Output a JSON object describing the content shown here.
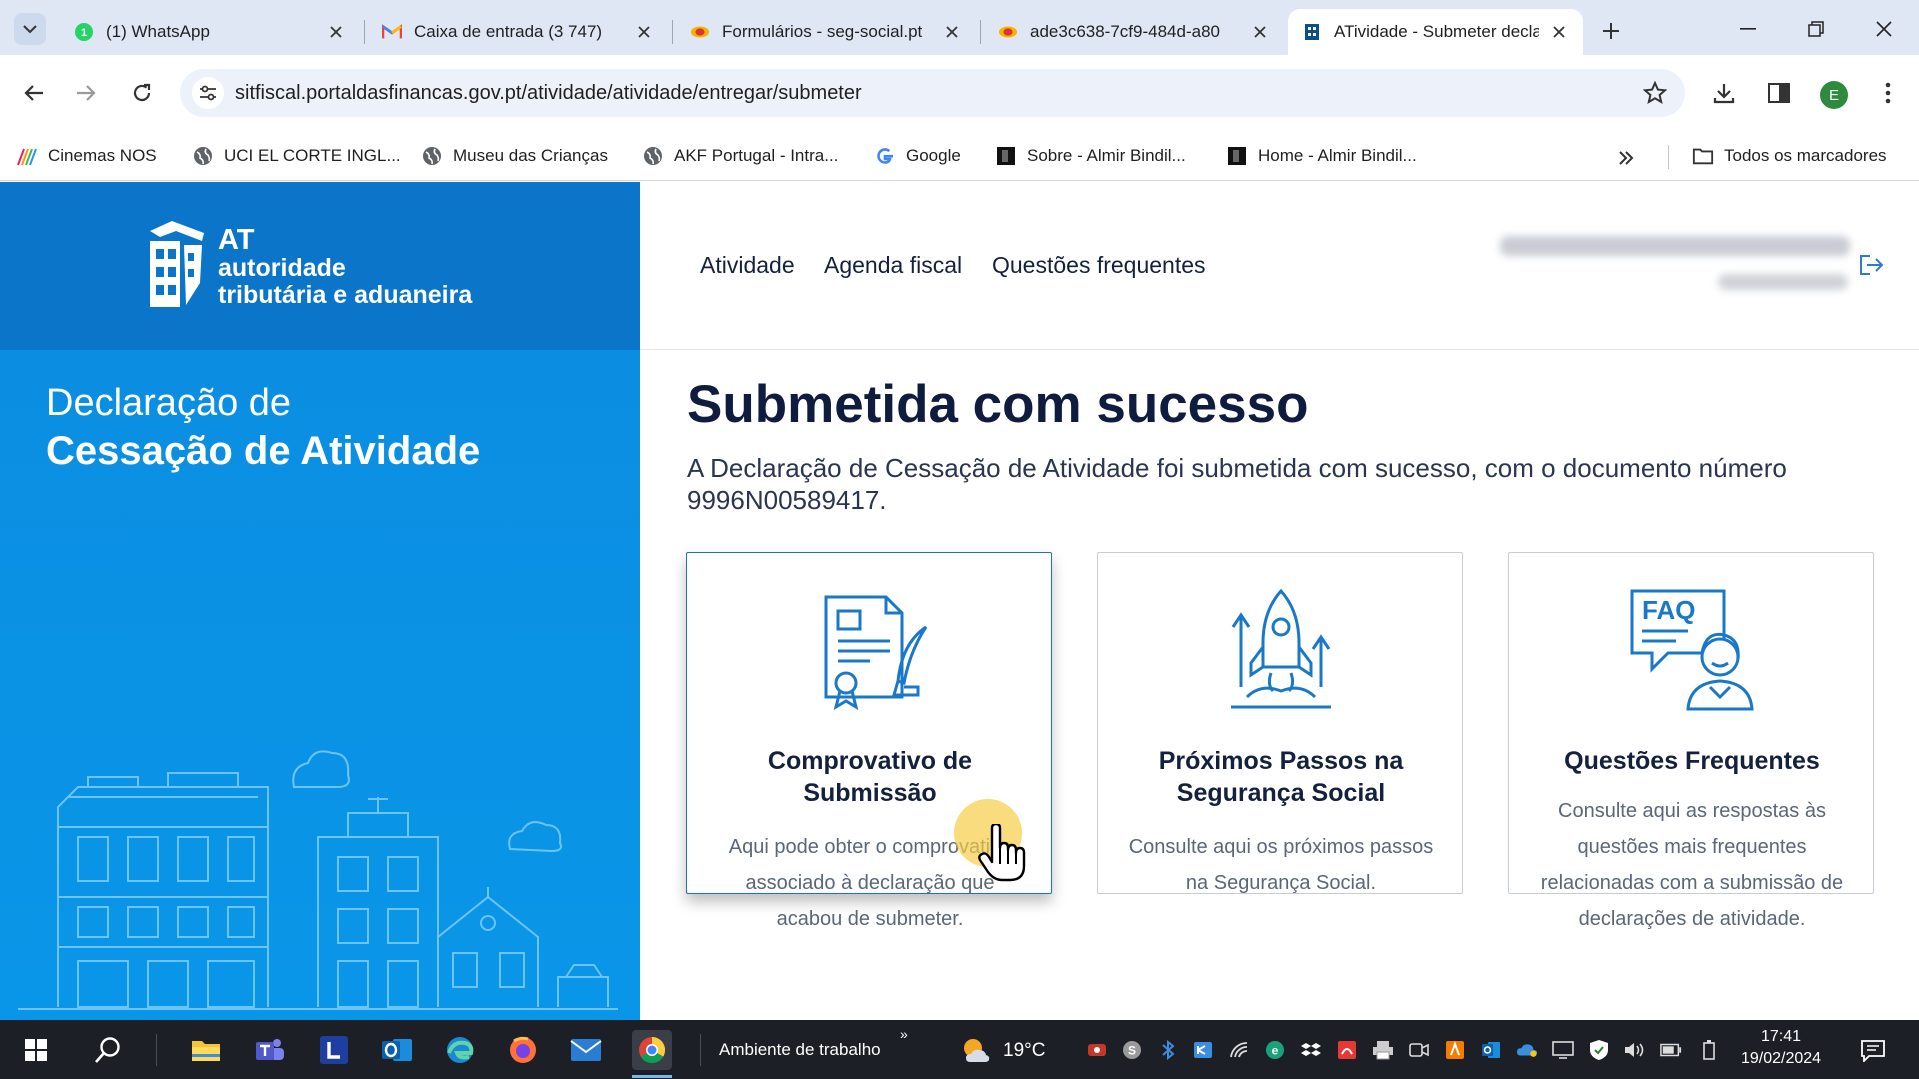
{
  "browser": {
    "tabs": [
      {
        "title": "(1) WhatsApp",
        "active": false
      },
      {
        "title": "Caixa de entrada (3 747)",
        "active": false
      },
      {
        "title": "Formulários - seg-social.pt",
        "active": false
      },
      {
        "title": "ade3c638-7cf9-484d-a80",
        "active": false
      },
      {
        "title": "ATividade - Submeter declaração",
        "active": true
      }
    ],
    "url": "sitfiscal.portaldasfinancas.gov.pt/atividade/atividade/entregar/submeter",
    "profile_initial": "E",
    "bookmarks": [
      "Cinemas NOS",
      "UCI EL CORTE INGL...",
      "Museu das Crianças",
      "AKF Portugal - Intra...",
      "Google",
      "Sobre - Almir Bindil...",
      "Home - Almir Bindil..."
    ],
    "all_bookmarks_label": "Todos os marcadores"
  },
  "page": {
    "logo": {
      "line1": "AT",
      "line2": "autoridade",
      "line3": "tributária e aduaneira"
    },
    "declaration": {
      "line1": "Declaração de",
      "line2": "Cessação de Atividade"
    },
    "nav": [
      "Atividade",
      "Agenda fiscal",
      "Questões frequentes"
    ],
    "title": "Submetida com sucesso",
    "description": "A Declaração de Cessação de Atividade foi submetida com sucesso, com o documento número 9996N00589417.",
    "cards": [
      {
        "title": "Comprovativo de Submissão",
        "desc": "Aqui pode obter o comprovativo associado à declaração que acabou de submeter."
      },
      {
        "title": "Próximos Passos na Segurança Social",
        "desc": "Consulte aqui os próximos passos na Segurança Social."
      },
      {
        "title": "Questões Frequentes",
        "desc": "Consulte aqui as respostas às questões mais frequentes relacionadas com a submissão de declarações de atividade."
      }
    ],
    "faq_badge": "FAQ"
  },
  "taskbar": {
    "desktop_label": "Ambiente de trabalho",
    "temperature": "19°C",
    "time": "17:41",
    "date": "19/02/2024"
  },
  "colors": {
    "brand_blue": "#0a75c9",
    "panel_blue": "#0a8fe4",
    "title_navy": "#0f1c3f",
    "icon_blue": "#1a78c8"
  }
}
